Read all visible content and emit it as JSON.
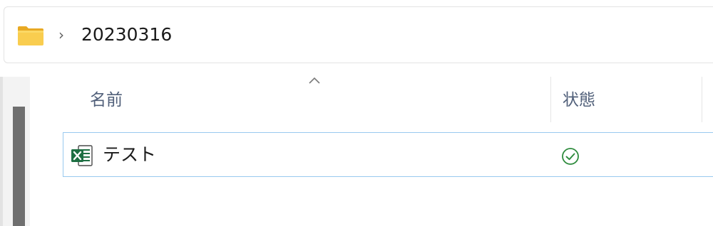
{
  "address_bar": {
    "folder_icon": "folder-icon",
    "separator": "›",
    "current_folder": "20230316"
  },
  "columns": {
    "name_label": "名前",
    "status_label": "状態",
    "sort_indicator": "chevron-up-icon"
  },
  "files": [
    {
      "name": "テスト",
      "icon": "excel-file-icon",
      "status_icon": "sync-ok-check-icon"
    }
  ],
  "colors": {
    "excel_green": "#1d6f42",
    "status_green": "#2e8b3d",
    "selection_border": "#99c9ef",
    "header_text": "#51607a",
    "folder_yellow": "#f5c542"
  }
}
